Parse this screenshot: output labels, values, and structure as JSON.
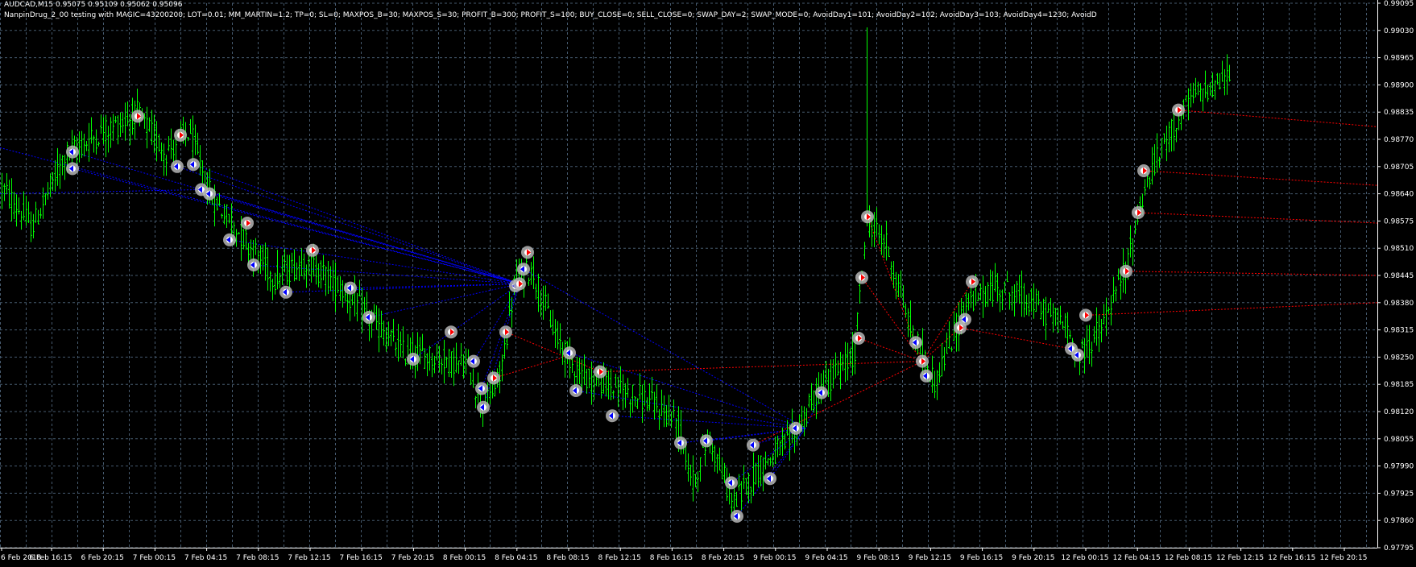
{
  "header": {
    "symbol_line": "AUDCAD,M15  0.95075 0.95109 0.95062 0.95096",
    "ea_line": "NanpinDrug_2_00 testing with MAGIC=43200200; LOT=0.01; MM_MARTIN=1.2; TP=0; SL=0; MAXPOS_B=30; MAXPOS_S=30; PROFIT_B=300; PROFIT_S=100; BUY_CLOSE=0; SELL_CLOSE=0; SWAP_DAY=2; SWAP_MODE=0; AvoidDay1=101; AvoidDay2=102; AvoidDay3=103; AvoidDay4=1230; AvoidD"
  },
  "colors": {
    "background": "#000000",
    "grid": "#465a6e",
    "candles": "#00ff00",
    "buy_line": "#0000ff",
    "sell_line": "#ff0000",
    "marker": "#b4b4b4",
    "text": "#ffffff"
  },
  "chart_data": {
    "type": "candlestick",
    "symbol": "AUDCAD",
    "timeframe": "M15",
    "grid": true,
    "y_ticks": [
      "0.99095",
      "0.99030",
      "0.98965",
      "0.98900",
      "0.98835",
      "0.98770",
      "0.98705",
      "0.98640",
      "0.98575",
      "0.98510",
      "0.98445",
      "0.98380",
      "0.98315",
      "0.98250",
      "0.98185",
      "0.98120",
      "0.98055",
      "0.97990",
      "0.97925",
      "0.97860",
      "0.97795"
    ],
    "y_range": [
      0.97795,
      0.99095
    ],
    "x_ticks": [
      "6 Feb 2018",
      "6 Feb 16:15",
      "6 Feb 20:15",
      "7 Feb 00:15",
      "7 Feb 04:15",
      "7 Feb 08:15",
      "7 Feb 12:15",
      "7 Feb 16:15",
      "7 Feb 20:15",
      "8 Feb 00:15",
      "8 Feb 04:15",
      "8 Feb 08:15",
      "8 Feb 12:15",
      "8 Feb 16:15",
      "8 Feb 20:15",
      "9 Feb 00:15",
      "9 Feb 04:15",
      "9 Feb 08:15",
      "9 Feb 12:15",
      "9 Feb 16:15",
      "9 Feb 20:15",
      "12 Feb 00:15",
      "12 Feb 04:15",
      "12 Feb 08:15",
      "12 Feb 12:15",
      "12 Feb 16:15",
      "12 Feb 20:15"
    ],
    "price_path": [
      [
        0,
        0.9866
      ],
      [
        40,
        0.9856
      ],
      [
        80,
        0.9873
      ],
      [
        120,
        0.9878
      ],
      [
        170,
        0.9883
      ],
      [
        205,
        0.9874
      ],
      [
        235,
        0.9879
      ],
      [
        260,
        0.9864
      ],
      [
        300,
        0.9854
      ],
      [
        340,
        0.9844
      ],
      [
        380,
        0.9848
      ],
      [
        420,
        0.9842
      ],
      [
        460,
        0.9834
      ],
      [
        500,
        0.9826
      ],
      [
        540,
        0.9825
      ],
      [
        580,
        0.9823
      ],
      [
        600,
        0.9813
      ],
      [
        620,
        0.982
      ],
      [
        640,
        0.9844
      ],
      [
        660,
        0.9846
      ],
      [
        690,
        0.983
      ],
      [
        720,
        0.9821
      ],
      [
        760,
        0.9818
      ],
      [
        800,
        0.9815
      ],
      [
        840,
        0.981
      ],
      [
        860,
        0.9795
      ],
      [
        880,
        0.9806
      ],
      [
        910,
        0.979
      ],
      [
        940,
        0.9798
      ],
      [
        980,
        0.9805
      ],
      [
        1020,
        0.9818
      ],
      [
        1060,
        0.9825
      ],
      [
        1076,
        0.9858
      ],
      [
        1100,
        0.9852
      ],
      [
        1130,
        0.9832
      ],
      [
        1160,
        0.9819
      ],
      [
        1200,
        0.9838
      ],
      [
        1240,
        0.9842
      ],
      [
        1280,
        0.9838
      ],
      [
        1320,
        0.9833
      ],
      [
        1340,
        0.9825
      ],
      [
        1370,
        0.9833
      ],
      [
        1400,
        0.9848
      ],
      [
        1420,
        0.9865
      ],
      [
        1450,
        0.9878
      ],
      [
        1480,
        0.9887
      ],
      [
        1525,
        0.9892
      ]
    ],
    "buy_markers": [
      [
        90,
        0.9874
      ],
      [
        90,
        0.987
      ],
      [
        220,
        0.98705
      ],
      [
        240,
        0.9871
      ],
      [
        250,
        0.9865
      ],
      [
        260,
        0.9864
      ],
      [
        285,
        0.9853
      ],
      [
        315,
        0.9847
      ],
      [
        355,
        0.98405
      ],
      [
        435,
        0.98415
      ],
      [
        458,
        0.98345
      ],
      [
        513,
        0.98245
      ],
      [
        588,
        0.9824
      ],
      [
        598,
        0.98175
      ],
      [
        600,
        0.9813
      ],
      [
        640,
        0.9842
      ],
      [
        650,
        0.9846
      ],
      [
        707,
        0.9826
      ],
      [
        715,
        0.9817
      ],
      [
        760,
        0.9811
      ],
      [
        845,
        0.98045
      ],
      [
        877,
        0.9805
      ],
      [
        908,
        0.9795
      ],
      [
        915,
        0.9787
      ],
      [
        935,
        0.9804
      ],
      [
        956,
        0.9796
      ],
      [
        988,
        0.9808
      ],
      [
        1020,
        0.98165
      ],
      [
        1137,
        0.98285
      ],
      [
        1150,
        0.98205
      ],
      [
        1198,
        0.9834
      ],
      [
        1330,
        0.9827
      ],
      [
        1338,
        0.98255
      ]
    ],
    "sell_markers": [
      [
        171,
        0.98825
      ],
      [
        224,
        0.9878
      ],
      [
        307,
        0.9857
      ],
      [
        388,
        0.98505
      ],
      [
        560,
        0.9831
      ],
      [
        613,
        0.982
      ],
      [
        628,
        0.9831
      ],
      [
        645,
        0.98425
      ],
      [
        655,
        0.985
      ],
      [
        745,
        0.98215
      ],
      [
        1066,
        0.98295
      ],
      [
        1070,
        0.9844
      ],
      [
        1077,
        0.98585
      ],
      [
        1145,
        0.9824
      ],
      [
        1192,
        0.9832
      ],
      [
        1207,
        0.9843
      ],
      [
        1348,
        0.9835
      ],
      [
        1398,
        0.98455
      ],
      [
        1413,
        0.98595
      ],
      [
        1420,
        0.98695
      ],
      [
        1463,
        0.9884
      ]
    ]
  }
}
